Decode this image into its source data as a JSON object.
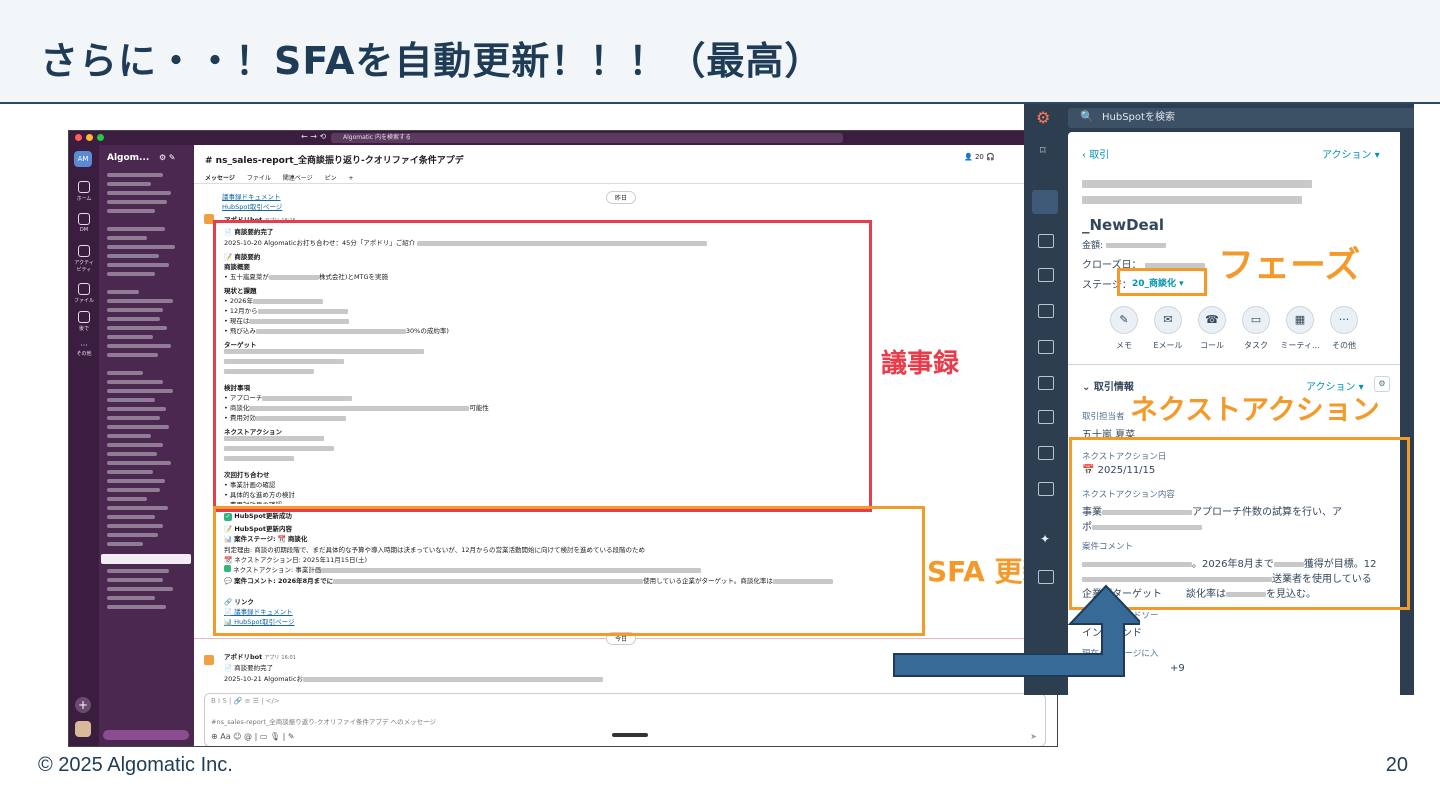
{
  "slide": {
    "title": "さらに・・！SFAを自動更新！！！（最高）",
    "footer": "© 2025 Algomatic Inc.",
    "page": "20"
  },
  "annotations": {
    "minutes": "議事録",
    "sfa_update": "SFA 更新",
    "phase": "フェーズ",
    "next_action": "ネクストアクション"
  },
  "slack": {
    "search_placeholder": "Algomatic 内を検索する",
    "workspace": "Algom...",
    "rail": [
      "ホーム",
      "DM",
      "アクティビティ",
      "ファイル",
      "後で",
      "その他"
    ],
    "channel": "# ns_sales-report_全商談振り返り-クオリファイ条件アプデ",
    "member_count": "20",
    "tabs": [
      "メッセージ",
      "ファイル",
      "関連ページ",
      "ピン"
    ],
    "top_links": [
      "議事録ドキュメント",
      "HubSpot取引ページ"
    ],
    "date_yesterday": "昨日",
    "date_today": "今日",
    "bot_name": "アポドリbot",
    "bot_tag": "アプリ",
    "bot_time1": "16:15",
    "bot_time2": "16:01",
    "summary_done": "商談要約完了",
    "summary_line": "2025-10-20 Algomaticお打ち合わせ：45分「アポドリ」ご紹介",
    "summary_title": "商談要約",
    "overview": "商談概要",
    "overview_line_a": "• 五十嵐夏菜が",
    "overview_line_b": "株式会社)とMTGを実施",
    "issues": "現状と課題",
    "issues_items": [
      "• 2026年",
      "• 12月から",
      "• 現在は",
      "• 飛び込み"
    ],
    "issues_tail": "30%の成約率)",
    "target": "ターゲット",
    "review": "検討事項",
    "review_items": [
      "• アプローチ",
      "• 商談化",
      "• 費用対効"
    ],
    "review_tail": "可能性",
    "next_actions": "ネクストアクション",
    "next_meeting": "次回打ち合わせ",
    "next_meeting_items": [
      "• 事業計画の確認",
      "• 具体的な進め方の検討",
      "• 費用対効果の確認"
    ],
    "hs_success": "HubSpot更新成功",
    "hs_content": "HubSpot更新内容",
    "deal_stage_label": "案件ステージ:",
    "deal_stage_value": "商談化",
    "reason": "判定理由: 商談の初期段階で、まだ具体的な予算や導入時期は決まっていないが、12月からの営業活動開始に向けて検討を進めている段階のため",
    "next_action_date": "ネクストアクション日: 2025年11月15日(土)",
    "next_action_line": "ネクストアクション: 事業計画",
    "deal_comment": "案件コメント: 2026年8月までに",
    "deal_comment_tail": "使用している企業がターゲット。商談化率は",
    "links_title": "リンク",
    "bottom_links": [
      "議事録ドキュメント",
      "HubSpot取引ページ"
    ],
    "second_summary_done": "商談要約完了",
    "second_line": "2025-10-21 Algomaticお",
    "composer_placeholder": "#ns_sales-report_全商談振り返り-クオリファイ条件アプデ へのメッセージ"
  },
  "hubspot": {
    "search_placeholder": "HubSpotを検索",
    "back": "取引",
    "actions_label": "アクション",
    "deal_name": "_NewDeal",
    "amount_label": "金額:",
    "close_label": "クローズ日：",
    "stage_label": "ステージ：",
    "stage_value": "20_商談化",
    "action_buttons": [
      "メモ",
      "Eメール",
      "コール",
      "タスク",
      "ミーティ...",
      "その他"
    ],
    "section_title": "取引情報",
    "owner_label": "取引担当者",
    "owner_value": "五十嵐 夏菜",
    "next_action_date_label": "ネクストアクション日",
    "next_action_date_value": "2025/11/15",
    "next_action_content_label": "ネクストアクション内容",
    "next_action_content_a": "事業",
    "next_action_content_b": "アプローチ件数の試算を行い、ア",
    "next_action_content_c": "ポ",
    "comment_label": "案件コメント",
    "comment_a": "。2026年8月まで",
    "comment_a2": "獲得が目標。12",
    "comment_b": "送業者を使用している",
    "comment_c1": "企業がターゲット",
    "comment_c2": "談化率は",
    "comment_c3": "を見込む。",
    "lead_source_label": "取引作成リードソー",
    "lead_source_value": "インバウンド",
    "stage_entered_label": "現在のステージに入",
    "stage_entered_tail": "+9"
  },
  "colors": {
    "title": "#1f3c57",
    "red_box": "#e83b4b",
    "orange_box": "#f39a2b",
    "arrow": "#386a98",
    "slack_sidebar": "#4a2850",
    "hubspot_nav": "#2d3e50"
  }
}
